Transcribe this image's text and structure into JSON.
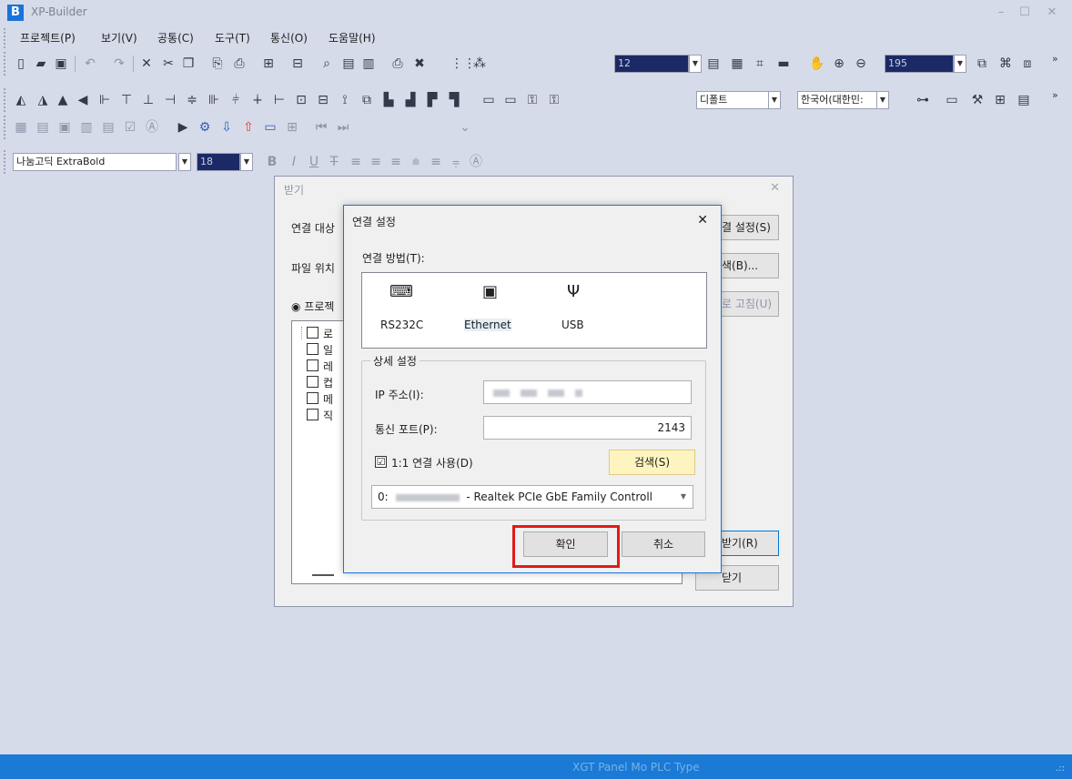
{
  "app": {
    "logo": "B",
    "title": "XP-Builder"
  },
  "window_controls": {
    "minimize": "–",
    "maximize": "☐",
    "close": "✕"
  },
  "menu": [
    "프로젝트(P)",
    "보기(V)",
    "공통(C)",
    "도구(T)",
    "통신(O)",
    "도움말(H)"
  ],
  "toolbar": {
    "zoom_step": "12",
    "zoom_percent": "195",
    "style_combo": "디폴트",
    "language_combo": "한국어(대한민:",
    "font_name": "나눔고딕 ExtraBold",
    "font_size": "18",
    "overflow": "»"
  },
  "receive_dialog": {
    "title": "받기",
    "connection_target_label": "연결 대상",
    "file_location_label": "파일 위치",
    "project_radio_label": "프로젝",
    "settings_button": "결 설정(S)",
    "browse_button": "색(B)...",
    "fix_button": "로 고침(U)",
    "receive_button": "받기(R)",
    "close_button": "닫기",
    "tree_items": [
      "로",
      "일",
      "레",
      "컵",
      "메",
      "직"
    ]
  },
  "connection_dialog": {
    "title": "연결 설정",
    "close": "✕",
    "method_label": "연결 방법(T):",
    "methods": [
      {
        "label": "RS232C",
        "icon": "serial-port-icon"
      },
      {
        "label": "Ethernet",
        "icon": "ethernet-port-icon",
        "selected": true
      },
      {
        "label": "USB",
        "icon": "usb-icon"
      }
    ],
    "detail_group_label": "상세 설정",
    "ip_label": "IP 주소(I):",
    "port_label": "통신 포트(P):",
    "port_value": "2143",
    "one_to_one_label": "1:1 연결 사용(D)",
    "one_to_one_checked": "☑",
    "search_button": "검색(S)",
    "adapter_prefix": "0:",
    "adapter_name": "- Realtek PCIe GbE Family Controll",
    "ok_button": "확인",
    "cancel_button": "취소"
  },
  "status_bar": {
    "text": "XGT Panel Mo  PLC Type",
    "grip": ".::"
  }
}
